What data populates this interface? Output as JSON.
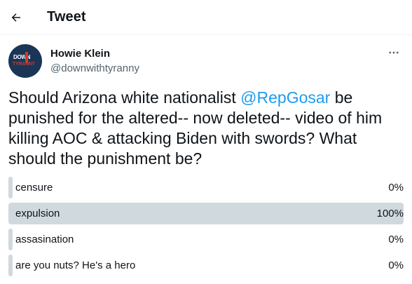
{
  "header": {
    "back_icon": "arrow-left-icon",
    "title": "Tweet"
  },
  "author": {
    "display_name": "Howie Klein",
    "handle": "@downwithtyranny",
    "avatar_text_line1": "DOWN",
    "avatar_text_line2": "TYRANNY",
    "more_icon": "more-horizontal-icon"
  },
  "tweet": {
    "text_before": "Should Arizona white nationalist ",
    "mention": "@RepGosar",
    "text_after": " be punished for the altered-- now deleted-- video of him killing AOC & attacking Biden with swords? What should the punishment be?"
  },
  "poll": {
    "options": [
      {
        "label": "censure",
        "percent_text": "0%",
        "fraction": 0.0
      },
      {
        "label": "expulsion",
        "percent_text": "100%",
        "fraction": 1.0
      },
      {
        "label": "assasination",
        "percent_text": "0%",
        "fraction": 0.0
      },
      {
        "label": "are you nuts? He's a hero",
        "percent_text": "0%",
        "fraction": 0.0
      }
    ]
  },
  "colors": {
    "accent": "#1d9bf0",
    "bar": "#cfd9de",
    "text": "#0f1419",
    "secondary": "#536471"
  }
}
